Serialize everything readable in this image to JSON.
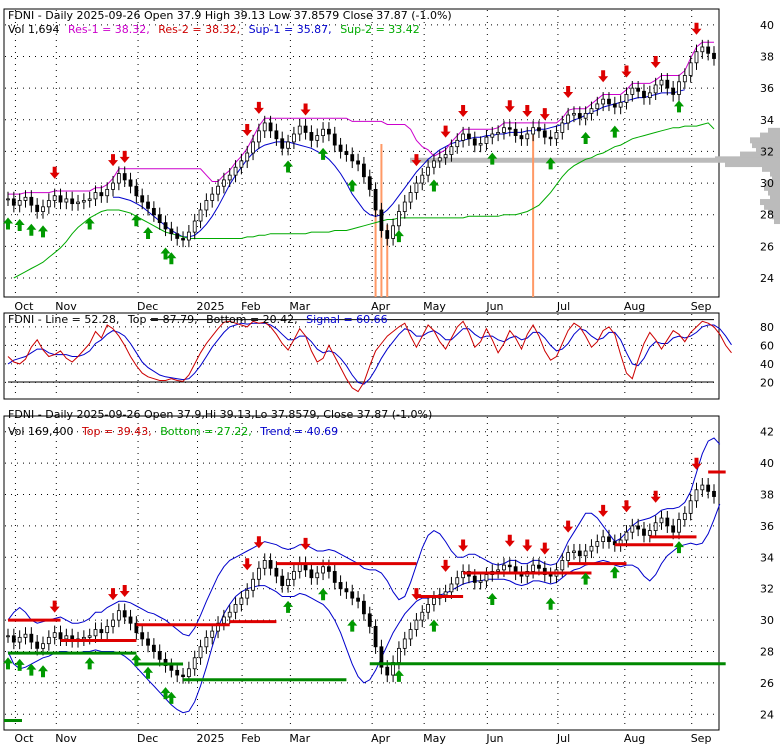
{
  "colors": {
    "up": "#008000",
    "down": "#000000",
    "res": "#cc00cc",
    "sup": "#0000cc",
    "sup2": "#00aa00",
    "arrow_up": "#009900",
    "arrow_down": "#dd0000",
    "volume": "#ff9966",
    "profile": "#bbbbbb",
    "line": "#cc0000",
    "signal": "#0000cc",
    "envelope": "#000000"
  },
  "months": [
    "Oct",
    "Nov",
    "Dec",
    "2025",
    "Feb",
    "Mar",
    "Apr",
    "May",
    "Jun",
    "Jul",
    "Aug",
    "Sep"
  ],
  "panel1": {
    "h_ticker": "FDNI - Daily 2025-09-26 Open 37.9   High 39.13   Low 37.8579   Close 37.87 (-1.0%)",
    "h_vol": "Vol 1,694",
    "h_res1": "Res-1 = 38.32,",
    "h_res2": "Res-2 = 38.32,",
    "h_sup1": "Sup-1 = 35.87,",
    "h_sup2": "Sup-2 = 33.42",
    "yticks": [
      "24",
      "26",
      "28",
      "30",
      "32",
      "34",
      "36",
      "38",
      "40"
    ],
    "ylim": [
      22.8,
      41.0
    ]
  },
  "panel2": {
    "h_ticker": "FDNI - Line = 52.28,",
    "h_top": "Top = 87.79,",
    "h_bottom": "Bottom = 20.42,",
    "h_signal": "Signal = 60.66",
    "yticks": [
      "20",
      "40",
      "60",
      "80"
    ],
    "ylim": [
      2,
      95
    ]
  },
  "panel3": {
    "h_ticker": "FDNI - Daily 2025-09-26 Open 37.9,Hi 39.13,Lo 37.8579, Close 37.87 (-1.0%)",
    "h_vol": "Vol 169,400",
    "h_top": "Top = 39.43,",
    "h_bottom": "Bottom = 27.22,",
    "h_trend": "Trend = 40.69",
    "yticks": [
      "24",
      "26",
      "28",
      "30",
      "32",
      "34",
      "36",
      "38",
      "40",
      "42"
    ],
    "ylim": [
      23.0,
      43.0
    ]
  },
  "chart_data": {
    "type": "candlestick",
    "title": "FDNI - Daily 2025-09-26",
    "closes": [
      29.0,
      28.6,
      28.9,
      29.1,
      28.6,
      28.2,
      28.5,
      28.9,
      29.2,
      28.8,
      29.0,
      28.7,
      28.8,
      28.9,
      29.0,
      29.4,
      29.2,
      29.6,
      30.0,
      30.6,
      30.2,
      29.8,
      29.2,
      28.8,
      28.4,
      28.0,
      27.5,
      27.1,
      26.8,
      26.5,
      26.4,
      26.9,
      27.6,
      28.3,
      28.9,
      29.3,
      29.8,
      30.2,
      30.5,
      31.0,
      31.4,
      31.9,
      32.6,
      33.3,
      33.8,
      33.3,
      32.8,
      32.2,
      32.6,
      33.1,
      33.6,
      33.2,
      32.7,
      33.0,
      33.4,
      33.1,
      32.4,
      32.0,
      31.8,
      31.4,
      31.2,
      30.4,
      29.6,
      28.3,
      27.0,
      26.5,
      27.3,
      28.2,
      28.8,
      29.4,
      30.0,
      30.5,
      31.0,
      31.4,
      31.6,
      31.8,
      32.3,
      32.7,
      33.1,
      32.8,
      32.4,
      32.5,
      32.9,
      33.1,
      33.2,
      33.5,
      33.4,
      33.0,
      32.8,
      33.1,
      33.5,
      33.3,
      32.9,
      32.8,
      33.2,
      33.8,
      34.3,
      34.4,
      34.1,
      34.4,
      34.7,
      35.0,
      35.3,
      35.0,
      34.8,
      35.1,
      35.6,
      36.0,
      35.8,
      35.4,
      35.7,
      36.2,
      36.5,
      36.0,
      35.6,
      36.4,
      36.8,
      37.6,
      38.3,
      38.6,
      38.2,
      37.87
    ],
    "ma_blue": [
      null,
      null,
      null,
      null,
      null,
      null,
      null,
      null,
      null,
      null,
      null,
      null,
      null,
      null,
      null,
      null,
      null,
      null,
      29.1,
      29.1,
      29.0,
      28.9,
      28.7,
      28.5,
      28.2,
      27.9,
      27.6,
      27.3,
      27.0,
      26.8,
      26.6,
      26.6,
      26.7,
      27.0,
      27.4,
      27.9,
      28.5,
      29.2,
      29.9,
      30.5,
      31.0,
      31.5,
      31.9,
      32.2,
      32.4,
      32.5,
      32.6,
      32.6,
      32.6,
      32.5,
      32.4,
      32.3,
      32.2,
      32.0,
      31.8,
      31.5,
      31.1,
      30.6,
      30.0,
      29.3,
      28.8,
      28.3,
      28.0,
      27.9,
      28.0,
      28.3,
      28.7,
      29.2,
      29.7,
      30.2,
      30.7,
      31.1,
      31.5,
      31.8,
      32.1,
      32.3,
      32.5,
      32.6,
      32.7,
      32.8,
      32.9,
      32.9,
      33.0,
      33.0,
      33.1,
      33.1,
      33.2,
      33.2,
      33.2,
      33.3,
      33.3,
      33.4,
      33.4,
      33.5,
      33.6,
      33.7,
      33.8,
      34.0,
      34.1,
      34.3,
      34.5,
      34.6,
      34.8,
      34.9,
      35.0,
      35.1,
      35.2,
      35.3,
      35.4,
      35.4,
      35.5,
      35.6,
      35.7,
      35.7,
      35.7,
      35.8,
      35.9
    ],
    "ma_green": [
      null,
      24.0,
      24.2,
      24.4,
      24.6,
      24.8,
      25.0,
      25.3,
      25.6,
      25.9,
      26.3,
      26.8,
      27.2,
      27.5,
      27.8,
      28.0,
      28.2,
      28.3,
      28.3,
      28.3,
      28.2,
      28.1,
      27.9,
      27.7,
      27.5,
      27.3,
      27.1,
      26.9,
      26.8,
      26.7,
      26.6,
      26.5,
      26.5,
      26.5,
      26.5,
      26.5,
      26.5,
      26.5,
      26.5,
      26.5,
      26.5,
      26.6,
      26.6,
      26.7,
      26.7,
      26.8,
      26.8,
      26.8,
      26.8,
      26.8,
      26.8,
      26.8,
      26.9,
      26.9,
      26.9,
      26.9,
      27.0,
      27.0,
      27.0,
      27.1,
      27.2,
      27.3,
      27.4,
      27.5,
      27.6,
      27.7,
      27.7,
      27.8,
      27.8,
      27.8,
      27.8,
      27.8,
      27.8,
      27.8,
      27.8,
      27.8,
      27.8,
      27.8,
      27.8,
      27.9,
      27.9,
      27.9,
      27.9,
      27.9,
      27.9,
      28.0,
      28.0,
      28.0,
      28.1,
      28.2,
      28.4,
      28.6,
      29.0,
      29.4,
      29.9,
      30.4,
      30.8,
      31.1,
      31.3,
      31.5,
      31.6,
      31.8,
      31.9,
      32.1,
      32.3,
      32.4,
      32.6,
      32.8,
      32.9,
      33.0,
      33.1,
      33.2,
      33.3,
      33.4,
      33.5,
      33.5,
      33.6,
      33.6,
      33.6,
      33.7,
      33.8,
      33.42
    ],
    "line_red": [
      48,
      42,
      40,
      45,
      58,
      66,
      55,
      48,
      50,
      54,
      46,
      42,
      48,
      55,
      62,
      75,
      68,
      82,
      78,
      70,
      60,
      48,
      38,
      30,
      26,
      24,
      22,
      22,
      24,
      22,
      21,
      28,
      40,
      52,
      62,
      70,
      78,
      85,
      86,
      84,
      82,
      80,
      86,
      84,
      85,
      80,
      72,
      62,
      55,
      66,
      78,
      70,
      54,
      42,
      46,
      60,
      48,
      36,
      24,
      14,
      10,
      20,
      38,
      54,
      62,
      70,
      75,
      80,
      84,
      70,
      58,
      70,
      82,
      76,
      64,
      56,
      68,
      80,
      86,
      74,
      58,
      64,
      78,
      66,
      52,
      62,
      76,
      68,
      56,
      72,
      82,
      70,
      54,
      44,
      48,
      62,
      76,
      84,
      80,
      70,
      58,
      64,
      76,
      80,
      72,
      50,
      30,
      24,
      44,
      62,
      74,
      66,
      56,
      66,
      76,
      72,
      64,
      74,
      80,
      86,
      84,
      80,
      72,
      60,
      52
    ],
    "signal_blue": [
      40,
      44,
      46,
      48,
      52,
      56,
      56,
      52,
      50,
      50,
      50,
      48,
      48,
      50,
      54,
      62,
      66,
      72,
      76,
      74,
      70,
      62,
      52,
      42,
      36,
      32,
      28,
      26,
      25,
      24,
      23,
      24,
      30,
      38,
      48,
      58,
      66,
      74,
      80,
      82,
      84,
      83,
      84,
      84,
      84,
      82,
      78,
      72,
      66,
      66,
      70,
      70,
      64,
      56,
      52,
      54,
      52,
      46,
      38,
      28,
      20,
      18,
      24,
      34,
      46,
      56,
      64,
      72,
      78,
      76,
      70,
      70,
      74,
      76,
      72,
      66,
      66,
      72,
      78,
      78,
      72,
      68,
      70,
      70,
      66,
      64,
      68,
      70,
      66,
      68,
      74,
      74,
      68,
      60,
      54,
      56,
      62,
      72,
      78,
      76,
      70,
      66,
      68,
      74,
      74,
      66,
      52,
      40,
      38,
      46,
      58,
      64,
      62,
      62,
      68,
      70,
      68,
      70,
      74,
      80,
      82,
      82,
      78,
      70,
      60.66
    ],
    "top_line": 87.79,
    "bottom_line": 20.42,
    "bb_upper": [
      30.0,
      30.5,
      30.8,
      30.5,
      30.0,
      29.8,
      29.9,
      30.0,
      30.1,
      30.2,
      30.0,
      29.8,
      29.8,
      29.9,
      30.1,
      30.5,
      30.5,
      30.8,
      31.0,
      31.2,
      31.2,
      31.1,
      30.9,
      30.7,
      30.5,
      30.4,
      30.2,
      30.0,
      29.7,
      29.4,
      29.1,
      29.0,
      29.5,
      30.3,
      31.2,
      32.0,
      32.8,
      33.4,
      33.8,
      34.0,
      34.2,
      34.4,
      34.6,
      34.8,
      35.0,
      34.9,
      34.8,
      34.6,
      34.5,
      34.6,
      34.8,
      34.8,
      34.6,
      34.4,
      34.4,
      34.5,
      34.4,
      34.2,
      34.0,
      33.8,
      33.6,
      33.3,
      33.2,
      33.2,
      33.0,
      32.5,
      31.8,
      31.3,
      31.5,
      32.4,
      33.5,
      34.6,
      35.4,
      35.7,
      35.5,
      35.0,
      34.4,
      34.0,
      34.0,
      34.2,
      34.2,
      34.0,
      33.8,
      33.6,
      33.5,
      33.6,
      33.8,
      33.8,
      33.6,
      33.6,
      33.8,
      33.8,
      33.6,
      33.5,
      33.6,
      34.2,
      35.0,
      35.6,
      36.2,
      36.8,
      36.8,
      36.5,
      36.0,
      35.5,
      35.0,
      35.2,
      35.6,
      36.0,
      36.3,
      36.4,
      36.5,
      36.7,
      37.0,
      37.1,
      37.1,
      37.2,
      37.5,
      38.2,
      39.4,
      40.6,
      41.4,
      41.6,
      41.2
    ],
    "bb_lower": [
      28.0,
      27.2,
      26.9,
      27.0,
      27.2,
      27.4,
      27.6,
      27.7,
      27.9,
      28.0,
      28.0,
      27.9,
      27.9,
      28.0,
      28.0,
      28.1,
      28.0,
      28.0,
      28.0,
      27.9,
      27.7,
      27.4,
      27.0,
      26.6,
      26.2,
      25.8,
      25.4,
      25.0,
      24.6,
      24.3,
      24.1,
      24.2,
      24.8,
      25.8,
      27.0,
      28.3,
      29.5,
      30.4,
      31.0,
      31.5,
      31.8,
      32.0,
      32.1,
      32.2,
      32.2,
      32.0,
      31.8,
      31.5,
      31.5,
      31.5,
      31.7,
      31.6,
      31.4,
      31.2,
      31.0,
      30.6,
      30.0,
      29.2,
      28.2,
      27.2,
      26.4,
      26.0,
      26.2,
      26.8,
      27.6,
      28.4,
      29.2,
      29.8,
      30.4,
      30.8,
      31.2,
      31.4,
      31.4,
      31.5,
      31.6,
      31.7,
      31.9,
      32.1,
      32.3,
      32.4,
      32.5,
      32.5,
      32.6,
      32.6,
      32.6,
      32.6,
      32.5,
      32.3,
      32.2,
      32.3,
      32.5,
      32.5,
      32.4,
      32.3,
      32.4,
      32.7,
      33.0,
      33.2,
      33.3,
      33.5,
      33.6,
      33.7,
      33.8,
      33.7,
      33.5,
      33.4,
      33.5,
      33.5,
      33.3,
      32.8,
      32.5,
      32.9,
      33.6,
      34.1,
      34.4,
      34.7,
      34.8,
      34.9,
      34.8,
      34.9,
      35.5,
      36.4,
      37.4
    ]
  }
}
